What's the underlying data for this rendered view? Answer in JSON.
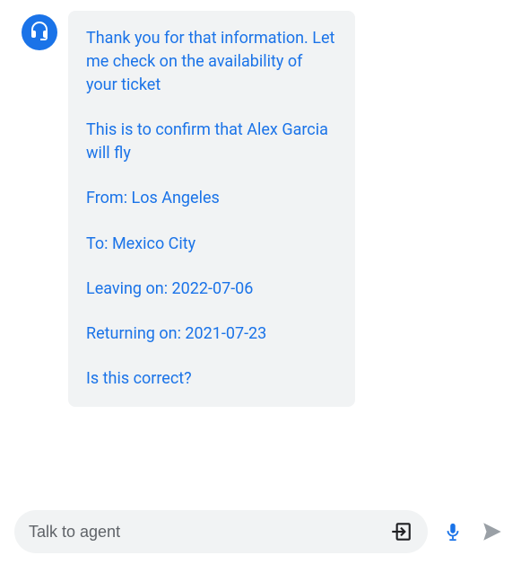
{
  "agent": {
    "avatar_icon": "headset-icon",
    "message": {
      "intro": "Thank you for that information. Let me check on the availability of your ticket",
      "confirm_line": "This is to confirm that Alex Garcia will fly",
      "from_line": "From: Los Angeles",
      "to_line": "To: Mexico City",
      "leaving_line": "Leaving on: 2022-07-06",
      "returning_line": "Returning on: 2021-07-23",
      "question": "Is this correct?"
    }
  },
  "input": {
    "placeholder": "Talk to agent"
  }
}
